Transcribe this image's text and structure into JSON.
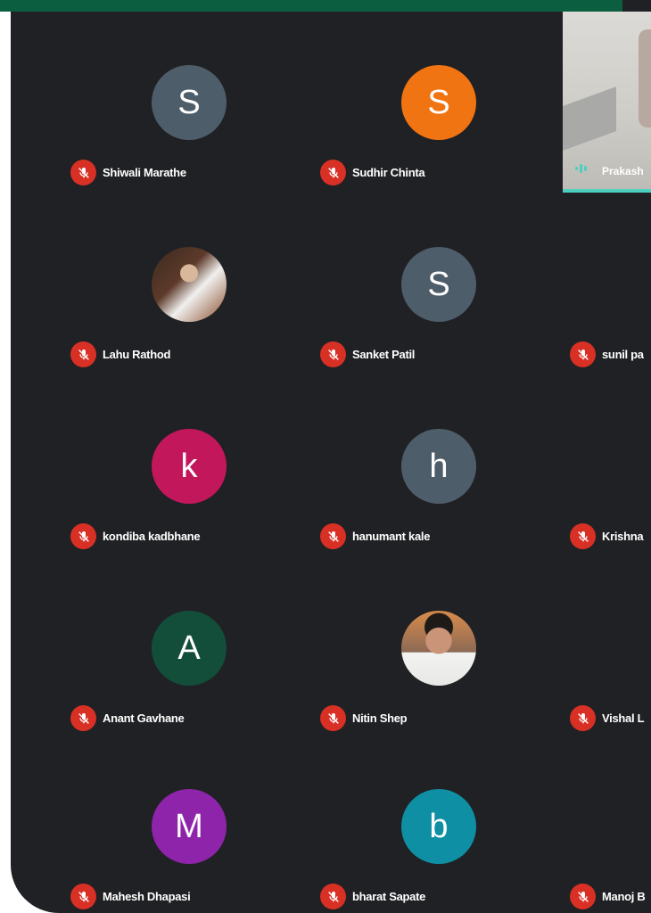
{
  "participants": [
    {
      "name": "Shiwali Marathe",
      "initial": "S",
      "color": "#4e5d6a",
      "photo": false,
      "muted": true
    },
    {
      "name": "Sudhir Chinta",
      "initial": "S",
      "color": "#f07412",
      "photo": false,
      "muted": true
    },
    {
      "name": "Lahu Rathod",
      "initial": "",
      "color": "#6b4a3a",
      "photo": true,
      "muted": true
    },
    {
      "name": "Sanket Patil",
      "initial": "S",
      "color": "#4e5d6a",
      "photo": false,
      "muted": true
    },
    {
      "name": "sunil pa",
      "initial": "",
      "color": "#3a3f44",
      "photo": false,
      "muted": true
    },
    {
      "name": "kondiba kadbhane",
      "initial": "k",
      "color": "#c2185b",
      "photo": false,
      "muted": true
    },
    {
      "name": "hanumant kale",
      "initial": "h",
      "color": "#4e5d6a",
      "photo": false,
      "muted": true
    },
    {
      "name": "Krishna",
      "initial": "",
      "color": "#00838f",
      "photo": false,
      "muted": true
    },
    {
      "name": "Anant Gavhane",
      "initial": "A",
      "color": "#134e3a",
      "photo": false,
      "muted": true
    },
    {
      "name": "Nitin Shep",
      "initial": "",
      "color": "#a0724f",
      "photo": true,
      "muted": true
    },
    {
      "name": "Vishal L",
      "initial": "",
      "color": "#c2185b",
      "photo": false,
      "muted": true
    },
    {
      "name": "Mahesh Dhapasi",
      "initial": "M",
      "color": "#8e24aa",
      "photo": false,
      "muted": true
    },
    {
      "name": "bharat Sapate",
      "initial": "b",
      "color": "#0e8fa3",
      "photo": false,
      "muted": true
    },
    {
      "name": "Manoj B",
      "initial": "",
      "color": "#2e7d32",
      "photo": false,
      "muted": true
    }
  ],
  "video_participant": {
    "name": "Prakash",
    "speaking": true
  },
  "icons": {
    "muted": "mic-off-icon",
    "speaking": "audio-wave-icon"
  },
  "colors": {
    "background": "#202124",
    "mute_red": "#d93025",
    "speaking_teal": "#4dd0c0",
    "top_bar": "#0b5e3f"
  }
}
